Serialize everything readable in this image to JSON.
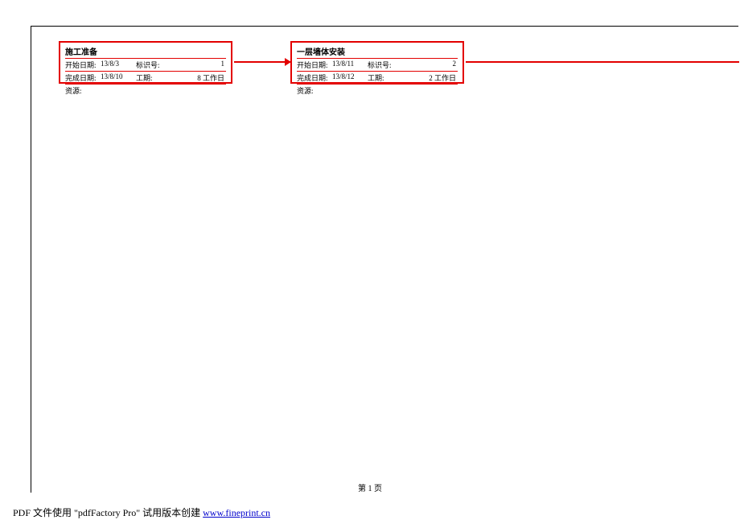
{
  "tasks": [
    {
      "title": "施工准备",
      "start_label": "开始日期:",
      "start_date": "13/8/3",
      "id_label": "标识号:",
      "id_value": "1",
      "finish_label": "完成日期:",
      "finish_date": "13/8/10",
      "duration_label": "工期:",
      "duration_value": "8 工作日",
      "resource_label": "资源:"
    },
    {
      "title": "一层墙体安装",
      "start_label": "开始日期:",
      "start_date": "13/8/11",
      "id_label": "标识号:",
      "id_value": "2",
      "finish_label": "完成日期:",
      "finish_date": "13/8/12",
      "duration_label": "工期:",
      "duration_value": "2 工作日",
      "resource_label": "资源:"
    }
  ],
  "page_number": "第 1 页",
  "footer_prefix": "PDF 文件使用 \"pdfFactory Pro\" 试用版本创建 ",
  "footer_link": "www.fineprint.cn"
}
